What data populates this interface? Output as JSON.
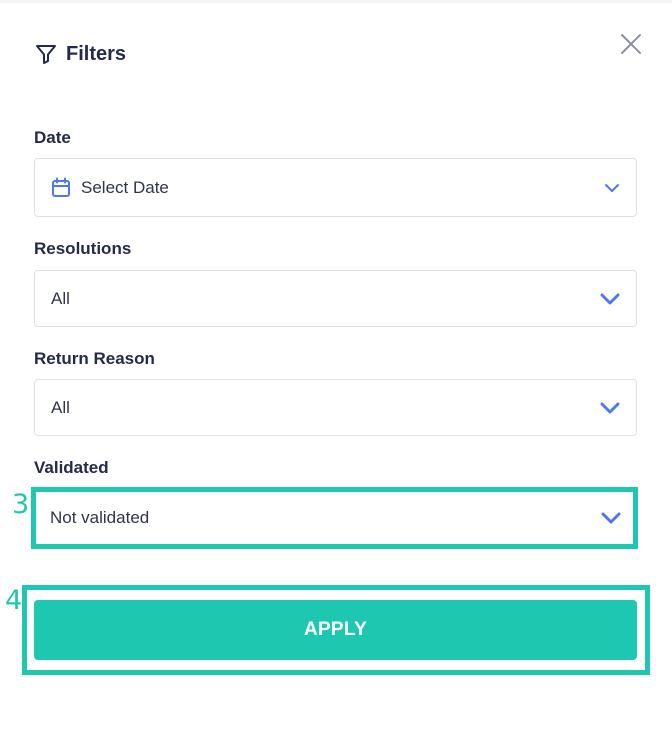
{
  "panel": {
    "title": "Filters",
    "icons": {
      "filter": "filter-icon",
      "close": "close-icon",
      "calendar": "calendar-icon",
      "chevron": "chevron-down-icon"
    }
  },
  "filters": {
    "date": {
      "label": "Date",
      "value": "Select Date"
    },
    "resolutions": {
      "label": "Resolutions",
      "value": "All"
    },
    "return_reason": {
      "label": "Return Reason",
      "value": "All"
    },
    "validated": {
      "label": "Validated",
      "value": "Not validated"
    }
  },
  "apply_label": "APPLY",
  "annotations": {
    "validated_marker": "3",
    "apply_marker": "4"
  },
  "colors": {
    "accent": "#1ec8b0",
    "text": "#232a4b",
    "chevron": "#4a78ee",
    "border": "#dde0e8"
  }
}
